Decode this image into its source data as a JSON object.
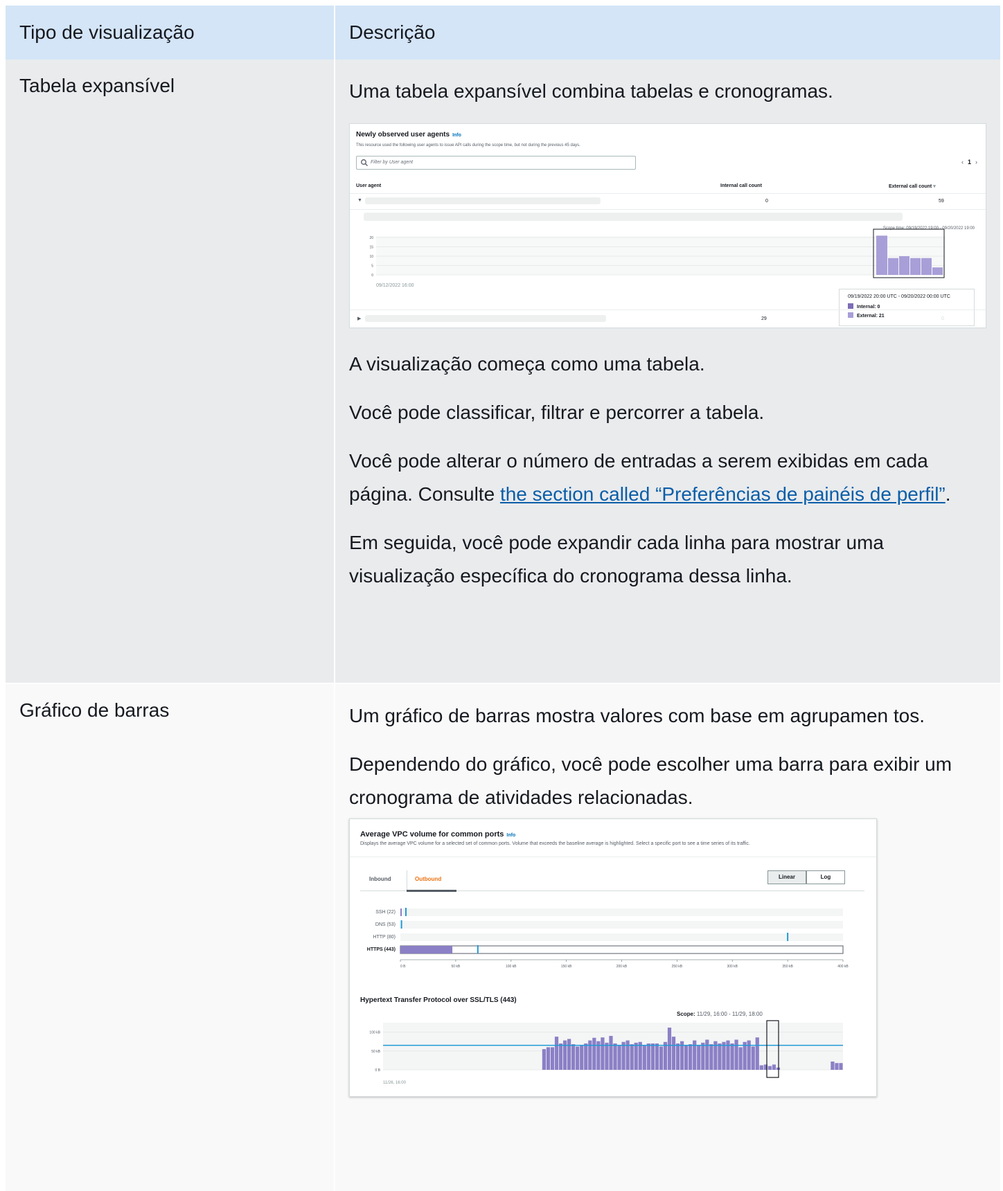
{
  "table": {
    "headers": [
      "Tipo de visualização",
      "Descrição"
    ],
    "row1": {
      "type": "Tabela expansível",
      "p1": "Uma tabela expansível combina tabelas e cronogramas.",
      "p2": "A visualização começa como uma tabela.",
      "p3": "Você pode classificar, filtrar e percorrer a tabela.",
      "p4_a": "Você pode alterar o número de entradas a serem exibidas em cada página. Consulte ",
      "p4_link": "the section called “Preferências de painéis de perfil”",
      "p4_b": ".",
      "p5": "Em seguida, você pode expandir cada linha para mostrar uma visualização específica do cronograma dessa linha."
    },
    "row2": {
      "type": "Gráfico de barras",
      "p1": "Um gráfico de barras mostra valores com base em agrupamen tos.",
      "p2": "Dependendo do gráfico, você pode escolher uma barra para exibir um cronograma de atividades relacionadas."
    }
  },
  "shot1": {
    "title": "Newly observed user agents",
    "info": "Info",
    "subtitle": "This resource used the following user agents to issue API calls during the scope time, but not during the previous 45 days.",
    "filter_placeholder": "Filter by User agent",
    "page": "1",
    "col_user_agent": "User agent",
    "col_internal": "Internal call count",
    "col_external": "External call count",
    "rows": [
      {
        "internal": "0",
        "external": "59"
      },
      {
        "internal": "29",
        "external": "0"
      }
    ],
    "scope": "Scope time: 09/19/2022 19:00 - 09/20/2022 19:00",
    "y_ticks": [
      "20",
      "15",
      "10",
      "5",
      "0"
    ],
    "x_start": "09/12/2022 16:00",
    "tooltip_range": "09/19/2022 20:00 UTC - 09/20/2022 00:00 UTC",
    "tooltip_internal": "Internal: 0",
    "tooltip_external": "External: 21",
    "internal_color": "#7d6db5",
    "external_color": "#a89fd8"
  },
  "shot2": {
    "title": "Average VPC volume for common ports",
    "info": "Info",
    "subtitle": "Displays the average VPC volume for a selected set of common ports. Volume that exceeds the baseline average is highlighted. Select a specific port to see a time series of its traffic.",
    "tab_inbound": "Inbound",
    "tab_outbound": "Outbound",
    "scale_linear": "Linear",
    "scale_log": "Log",
    "ports": [
      "SSH (22)",
      "DNS (53)",
      "HTTP (80)",
      "HTTPS (443)"
    ],
    "x_ticks": [
      "0 B",
      "50 kB",
      "100 kB",
      "150 kB",
      "200 kB",
      "250 kB",
      "300 kB",
      "350 kB",
      "400 kB"
    ],
    "detail_title": "Hypertext Transfer Protocol over SSL/TLS (443)",
    "scope_label": "Scope:",
    "scope_value": "11/29, 16:00 - 11/29, 18:00",
    "y_ticks": [
      "100 kB",
      "50 kB",
      "0 B"
    ],
    "x_start": "11/26, 16:00",
    "bar_color": "#8b80c6",
    "baseline_color": "#1f9ad6"
  },
  "chart_data": [
    {
      "type": "bar",
      "title": "",
      "xlabel": "",
      "ylabel": "",
      "ylim": [
        0,
        20
      ],
      "x_start_label": "09/12/2022 16:00",
      "series": [
        {
          "name": "Internal",
          "values": [
            0,
            0,
            0,
            0,
            0,
            0
          ]
        },
        {
          "name": "External",
          "values": [
            21,
            9,
            10,
            9,
            9,
            4
          ]
        }
      ]
    },
    {
      "type": "bar",
      "title": "",
      "xlabel": "",
      "ylabel": "",
      "categories": [
        "SSH (22)",
        "DNS (53)",
        "HTTP (80)",
        "HTTPS (443)"
      ],
      "values_kB": [
        1,
        0,
        0,
        47
      ],
      "baseline_kB": [
        5,
        1,
        350,
        70
      ],
      "xlim": [
        0,
        400
      ]
    },
    {
      "type": "bar",
      "title": "Hypertext Transfer Protocol over SSL/TLS (443)",
      "x_start_label": "11/26, 16:00",
      "ylim_kB": [
        0,
        125
      ],
      "baseline_kB": 65,
      "values_kB": [
        0,
        0,
        0,
        0,
        0,
        0,
        0,
        0,
        0,
        0,
        0,
        0,
        0,
        0,
        0,
        0,
        0,
        0,
        0,
        0,
        0,
        0,
        0,
        0,
        0,
        0,
        0,
        0,
        0,
        0,
        0,
        0,
        0,
        0,
        0,
        0,
        0,
        0,
        55,
        60,
        60,
        88,
        70,
        78,
        82,
        68,
        62,
        66,
        70,
        78,
        85,
        76,
        86,
        72,
        90,
        70,
        65,
        74,
        78,
        68,
        72,
        74,
        66,
        70,
        70,
        70,
        62,
        74,
        112,
        88,
        70,
        76,
        66,
        68,
        78,
        66,
        72,
        80,
        68,
        76,
        70,
        74,
        78,
        70,
        80,
        60,
        74,
        78,
        62,
        86,
        12,
        14,
        10,
        14,
        6,
        0,
        0,
        0,
        0,
        0,
        0,
        0,
        0,
        0,
        0,
        0,
        0,
        22,
        18,
        18
      ]
    }
  ]
}
